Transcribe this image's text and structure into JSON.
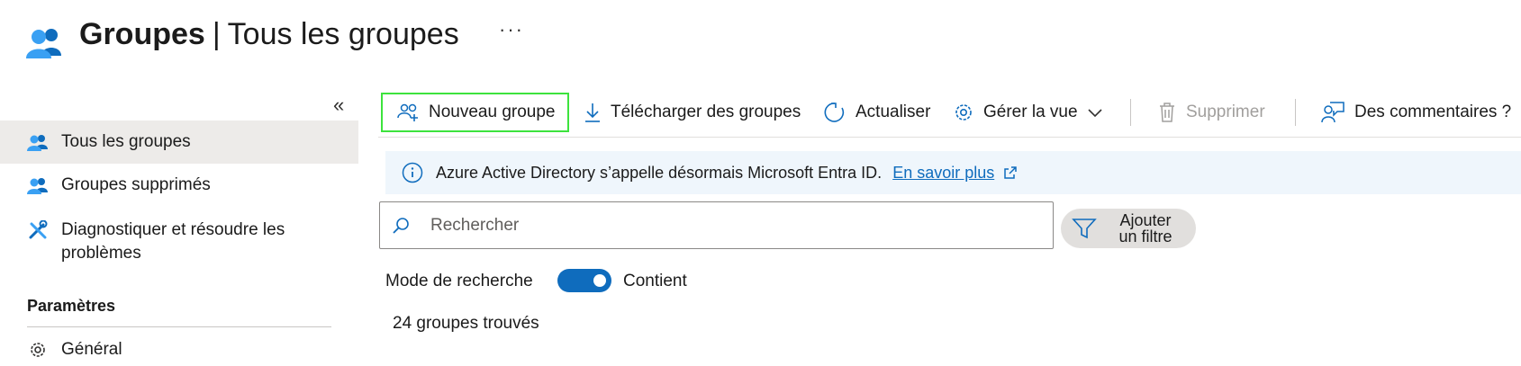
{
  "header": {
    "title_bold": "Groupes",
    "separator": "|",
    "title_rest": "Tous les groupes",
    "more_label": "···"
  },
  "sidebar": {
    "collapse_glyph": "«",
    "items": [
      {
        "label": "Tous les groupes",
        "icon": "groups-icon",
        "active": true
      },
      {
        "label": "Groupes supprimés",
        "icon": "groups-icon",
        "active": false
      },
      {
        "label": "Diagnostiquer et résoudre les",
        "label2": "problèmes",
        "icon": "tools-icon",
        "active": false
      }
    ],
    "section_title": "Paramètres",
    "settings_items": [
      {
        "label": "Général",
        "icon": "gear-icon"
      }
    ]
  },
  "toolbar": {
    "new_group": "Nouveau groupe",
    "download": "Télécharger des groupes",
    "refresh": "Actualiser",
    "manage_view": "Gérer la vue",
    "delete": "Supprimer",
    "feedback": "Des commentaires ?"
  },
  "banner": {
    "text": "Azure Active Directory s’appelle désormais Microsoft Entra ID.",
    "link": "En savoir plus"
  },
  "search": {
    "placeholder": "Rechercher",
    "value": ""
  },
  "filter": {
    "line1": "Ajouter",
    "line2": "un filtre"
  },
  "search_mode": {
    "label": "Mode de recherche",
    "value": "Contient",
    "enabled": true
  },
  "results": {
    "count_text": "24 groupes trouvés"
  },
  "colors": {
    "accent": "#0f6cbd",
    "highlight": "#3de33d",
    "banner_bg": "#eff6fc",
    "active_bg": "#edebe9"
  }
}
